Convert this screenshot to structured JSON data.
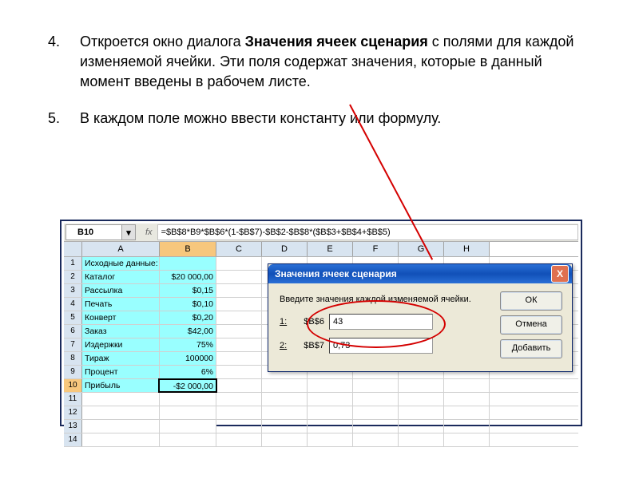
{
  "list": {
    "n4": "4.",
    "t4a": "Откроется окно диалога ",
    "t4b": "Значения ячеек сценария",
    "t4c": "  с полями для каждой изменяемой ячейки. Эти поля содержат значения, которые в данный момент введены в рабочем листе.",
    "n5": "5.",
    "t5": "В каждом поле можно ввести константу или формулу."
  },
  "excel": {
    "namebox": "B10",
    "fx": "fx",
    "formula": "=$B$8*B9*$B$6*(1-$B$7)-$B$2-$B$8*($B$3+$B$4+$B$5)",
    "cols": [
      "A",
      "B",
      "C",
      "D",
      "E",
      "F",
      "G",
      "H"
    ],
    "rows": [
      {
        "r": "1",
        "a": "Исходные данные:",
        "b": ""
      },
      {
        "r": "2",
        "a": "Каталог",
        "b": "$20 000,00"
      },
      {
        "r": "3",
        "a": "Рассылка",
        "b": "$0,15"
      },
      {
        "r": "4",
        "a": "Печать",
        "b": "$0,10"
      },
      {
        "r": "5",
        "a": "Конверт",
        "b": "$0,20"
      },
      {
        "r": "6",
        "a": "Заказ",
        "b": "$42,00"
      },
      {
        "r": "7",
        "a": "Издержки",
        "b": "75%"
      },
      {
        "r": "8",
        "a": "Тираж",
        "b": "100000"
      },
      {
        "r": "9",
        "a": "Процент",
        "b": "6%"
      },
      {
        "r": "10",
        "a": "Прибыль",
        "b": "-$2 000,00"
      },
      {
        "r": "11",
        "a": "",
        "b": ""
      },
      {
        "r": "12",
        "a": "",
        "b": ""
      },
      {
        "r": "13",
        "a": "",
        "b": ""
      },
      {
        "r": "14",
        "a": "",
        "b": ""
      }
    ]
  },
  "dialog": {
    "title": "Значения ячеек сценария",
    "close": "X",
    "instr": "Введите значения каждой изменяемой ячейки.",
    "l1": "1:",
    "ref1": "$B$6",
    "val1": "43",
    "l2": "2:",
    "ref2": "$B$7",
    "val2": "0,73",
    "ok": "ОК",
    "cancel": "Отмена",
    "add": "Добавить"
  }
}
